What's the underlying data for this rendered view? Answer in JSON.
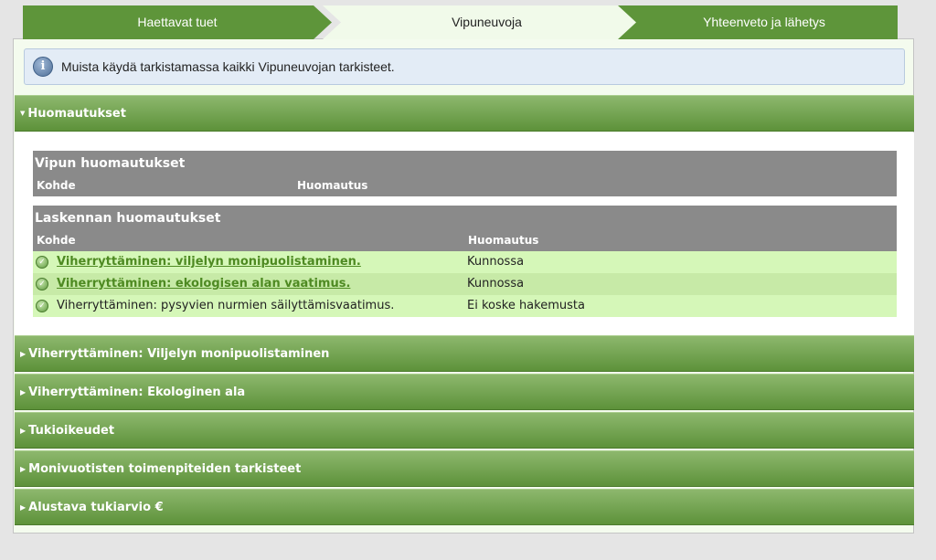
{
  "steps": [
    "Haettavat tuet",
    "Vipuneuvoja",
    "Yhteenveto ja lähetys"
  ],
  "info": {
    "icon": "info-icon",
    "text": "Muista käydä tarkistamassa kaikki Vipuneuvojan tarkisteet."
  },
  "sections": {
    "open": {
      "label": "Huomautukset",
      "arrow": "▼"
    },
    "collapsed": [
      {
        "label": "Viherryttäminen: Viljelyn monipuolistaminen",
        "arrow": "▶"
      },
      {
        "label": "Viherryttäminen: Ekologinen ala",
        "arrow": "▶"
      },
      {
        "label": "Tukioikeudet",
        "arrow": "▶"
      },
      {
        "label": "Monivuotisten toimenpiteiden tarkisteet",
        "arrow": "▶"
      },
      {
        "label": "Alustava tukiarvio €",
        "arrow": "▶"
      }
    ]
  },
  "vipu": {
    "title": "Vipun huomautukset",
    "col_kohde": "Kohde",
    "col_huom": "Huomautus"
  },
  "laskenta": {
    "title": "Laskennan huomautukset",
    "col_kohde": "Kohde",
    "col_huom": "Huomautus",
    "rows": [
      {
        "kohde": "Viherryttäminen: viljelyn monipuolistaminen.",
        "huomautus": "Kunnossa",
        "link": true
      },
      {
        "kohde": "Viherryttäminen: ekologisen alan vaatimus.",
        "huomautus": "Kunnossa",
        "link": true
      },
      {
        "kohde": "Viherryttäminen: pysyvien nurmien säilyttämisvaatimus.",
        "huomautus": "Ei koske hakemusta",
        "link": false
      }
    ],
    "check_glyph": "✓"
  }
}
